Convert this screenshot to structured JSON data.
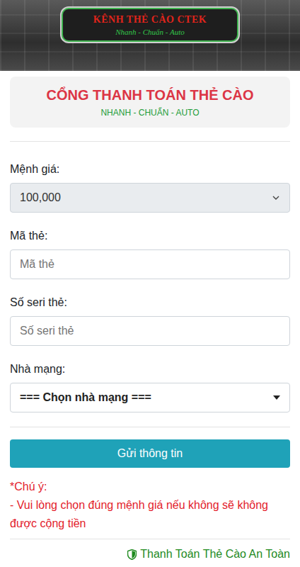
{
  "banner": {
    "title": "KÊNH THẺ CÀO CTEK",
    "tagline": "Nhanh - Chuẩn - Auto"
  },
  "header": {
    "title": "CỔNG THANH TOÁN THẺ CÀO",
    "subtitle": "NHANH - CHUẨN - AUTO"
  },
  "fields": [
    {
      "kind": "select",
      "label": "Mệnh giá:",
      "value": "100,000",
      "placeholder": "",
      "disabled": true
    },
    {
      "kind": "input",
      "label": "Mã thẻ:",
      "value": "",
      "placeholder": "Mã thẻ",
      "disabled": false
    },
    {
      "kind": "input",
      "label": "Số seri thẻ:",
      "value": "",
      "placeholder": "Số seri thẻ",
      "disabled": false
    },
    {
      "kind": "select",
      "label": "Nhà mạng:",
      "value": "=== Chọn nhà mạng ===",
      "placeholder": "",
      "disabled": false
    }
  ],
  "submit": "Gửi thông tin",
  "notice": {
    "title": "*Chú ý:",
    "lines": [
      "- Vui lòng chọn đúng mệnh giá nếu không sẽ không được cộng tiền"
    ]
  },
  "footer": "Thanh Toán Thẻ Cào An Toàn"
}
